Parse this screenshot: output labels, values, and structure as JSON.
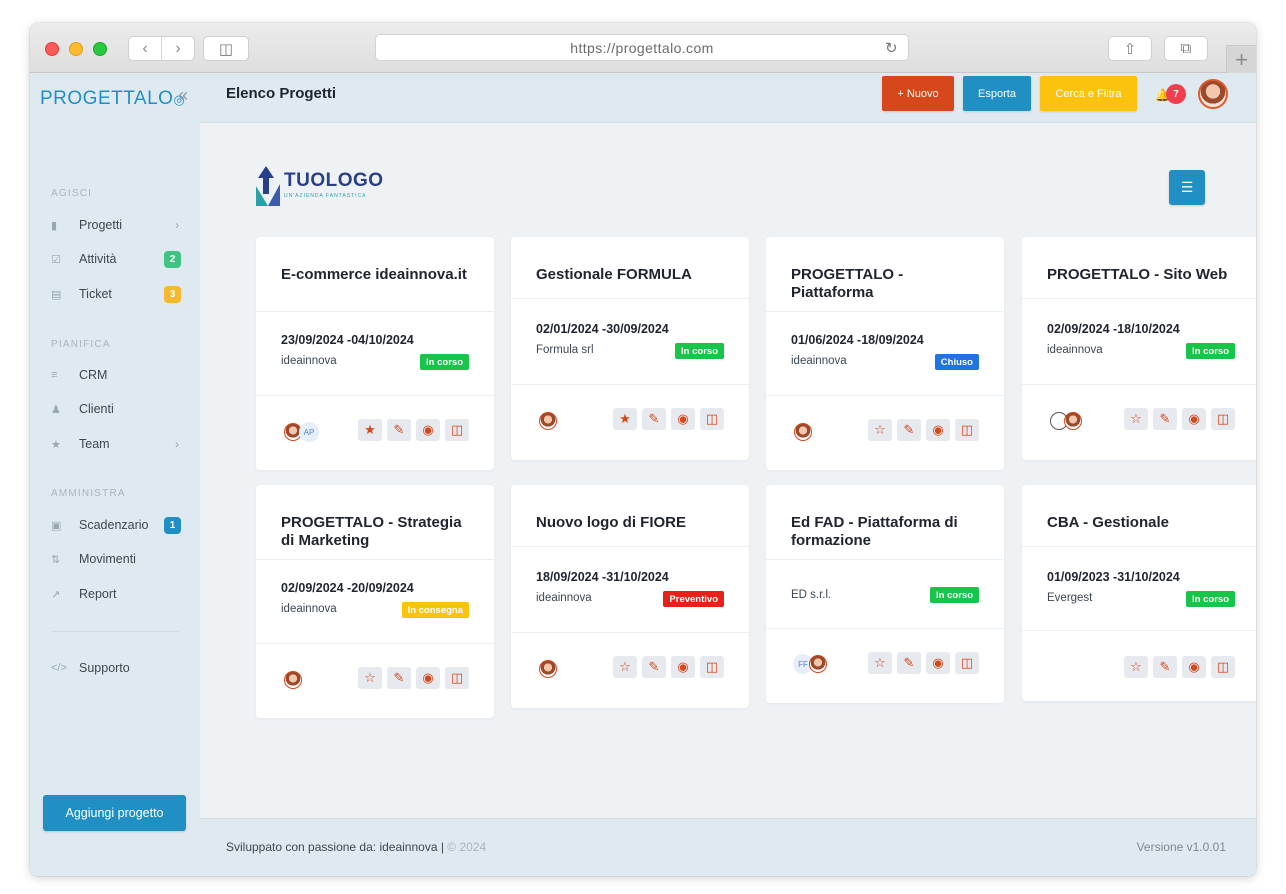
{
  "browser": {
    "url": "https://progettalo.com"
  },
  "sidebar": {
    "logo": "PROGETTALO",
    "sections": {
      "act": "AGISCI",
      "plan": "PIANIFICA",
      "admin": "AMMINISTRA"
    },
    "items": [
      {
        "label": "Progetti",
        "badge": ""
      },
      {
        "label": "Attività",
        "badge": "2"
      },
      {
        "label": "Ticket",
        "badge": "3"
      },
      {
        "label": "CRM",
        "badge": ""
      },
      {
        "label": "Clienti",
        "badge": ""
      },
      {
        "label": "Team",
        "badge": ""
      },
      {
        "label": "Scadenzario",
        "badge": "1"
      },
      {
        "label": "Movimenti",
        "badge": ""
      },
      {
        "label": "Report",
        "badge": ""
      },
      {
        "label": "Supporto",
        "badge": ""
      }
    ],
    "badge_colors": {
      "green": "#3fc483",
      "yellow": "#f7b92b",
      "blue": "#1f8fc4"
    },
    "add_button": "Aggiungi progetto"
  },
  "header": {
    "title": "Elenco Progetti",
    "new_button": "+ Nuovo",
    "export_button": "Esporta",
    "filter_button": "Cerca e Filtra",
    "notifications": "7",
    "colors": {
      "new": "#d6471b",
      "export": "#1f8fc4",
      "filter": "#fbc30d"
    }
  },
  "content": {
    "logo_text": "TUOLOGO",
    "logo_tagline": "UN'AZIENDA FANTASTICA"
  },
  "cards": [
    {
      "title": "E-commerce ideainnova.it",
      "dates": "23/09/2024 -04/10/2024",
      "client": "ideainnova",
      "status": "In corso",
      "status_color": "#19c44a",
      "starred": true,
      "avatar_initials": "AP"
    },
    {
      "title": "Gestionale FORMULA",
      "dates": "02/01/2024 -30/09/2024",
      "client": "Formula srl",
      "status": "In corso",
      "status_color": "#19c44a",
      "starred": true,
      "avatar_initials": ""
    },
    {
      "title": "PROGETTALO - Piattaforma",
      "dates": "01/06/2024 -18/09/2024",
      "client": "ideainnova",
      "status": "Chiuso",
      "status_color": "#1f74e0",
      "starred": false,
      "avatar_initials": ""
    },
    {
      "title": "PROGETTALO - Sito Web",
      "dates": "02/09/2024 -18/10/2024",
      "client": "ideainnova",
      "status": "In corso",
      "status_color": "#19c44a",
      "starred": false,
      "avatar_initials": ""
    },
    {
      "title": "PROGETTALO - Strategia di Marketing",
      "dates": "02/09/2024 -20/09/2024",
      "client": "ideainnova",
      "status": "In consegna",
      "status_color": "#fbc30d",
      "starred": false,
      "avatar_initials": ""
    },
    {
      "title": "Nuovo logo di FIORE",
      "dates": "18/09/2024 -31/10/2024",
      "client": "ideainnova",
      "status": "Preventivo",
      "status_color": "#e8201a",
      "starred": false,
      "avatar_initials": ""
    },
    {
      "title": "Ed FAD - Piattaforma di formazione",
      "dates": "",
      "client": "ED s.r.l.",
      "status": "In corso",
      "status_color": "#19c44a",
      "starred": false,
      "avatar_initials": "FF"
    },
    {
      "title": "CBA - Gestionale",
      "dates": "01/09/2023 -31/10/2024",
      "client": "Evergest",
      "status": "In corso",
      "status_color": "#19c44a",
      "starred": false,
      "avatar_initials": ""
    }
  ],
  "footer": {
    "text": "Sviluppato con passione da: ideainnova |",
    "year": "© 2024",
    "version": "Versione v1.0.01"
  }
}
